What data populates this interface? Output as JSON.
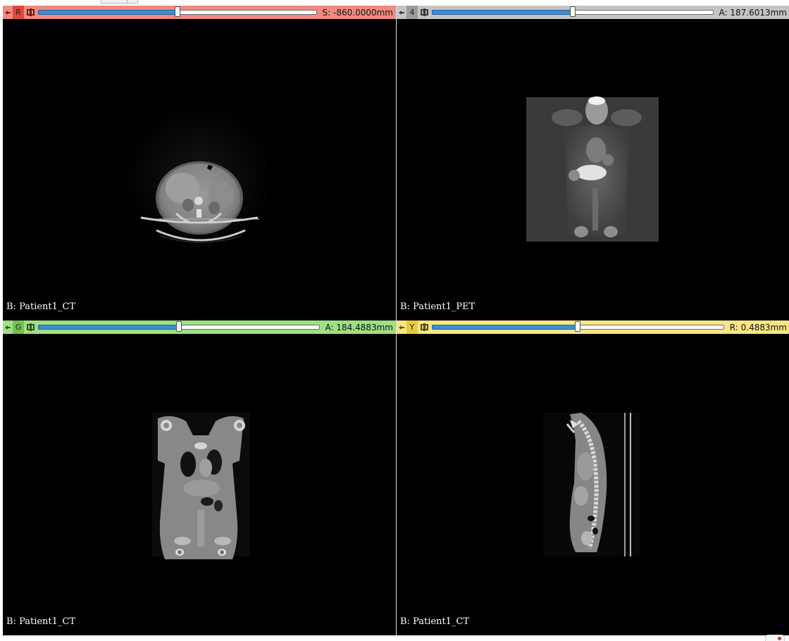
{
  "colors": {
    "red_bar": "#f08a80",
    "red_letter_bg": "#e04a3d",
    "gray_bar": "#c4c4c4",
    "gray_letter_bg": "#9c9c9c",
    "green_bar": "#9ee082",
    "green_letter_bg": "#6fc24e",
    "yellow_bar": "#f7e586",
    "yellow_letter_bg": "#e9cc3c"
  },
  "views": [
    {
      "id": "red",
      "letter": "R",
      "offset": "S: -860.0000mm",
      "slider_fraction": 0.5,
      "label": "B: Patient1_CT",
      "scan": "axial-ct"
    },
    {
      "id": "gray",
      "letter": "4",
      "offset": "A: 187.6013mm",
      "slider_fraction": 0.5,
      "label": "B: Patient1_PET",
      "scan": "coronal-pet"
    },
    {
      "id": "green",
      "letter": "G",
      "offset": "A: 184.4883mm",
      "slider_fraction": 0.5,
      "label": "B: Patient1_CT",
      "scan": "coronal-ct"
    },
    {
      "id": "yellow",
      "letter": "Y",
      "offset": "R: 0.4883mm",
      "slider_fraction": 0.5,
      "label": "B: Patient1_CT",
      "scan": "sagittal-ct"
    }
  ]
}
